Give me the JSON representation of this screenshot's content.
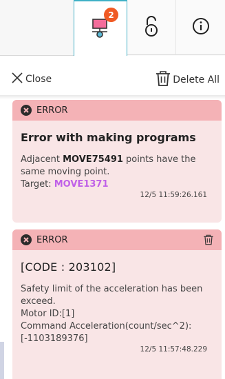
{
  "tabs": {
    "network_badge": "2",
    "network_icon": "network-alert-icon",
    "lock_icon": "unlock-icon",
    "info_icon": "info-icon",
    "colors": {
      "accent": "#3fb0c6",
      "badge": "#f05a24",
      "network_top": "#f46d9b",
      "network_bottom": "#5bb9d6"
    }
  },
  "toolbar": {
    "close_label": "Close",
    "delete_all_label": "Delete All"
  },
  "alerts": [
    {
      "level": "ERROR",
      "title": "Error with making programs",
      "msg_pre": "Adjacent ",
      "msg_bold": "MOVE75491",
      "msg_post": " points have the same moving point.",
      "target_label": "Target: ",
      "target_value": "MOVE1371",
      "timestamp": "12/5 11:59:26.161"
    },
    {
      "level": "ERROR",
      "title": "[CODE : 203102]",
      "line1": "Safety limit of the acceleration has been exceed.",
      "line2": "Motor ID:[1]",
      "line3": "Command Acceleration(count/sec^2):[-1103189376]",
      "timestamp": "12/5 11:57:48.229"
    }
  ],
  "colors": {
    "card_bg": "#f9e5e6",
    "card_header": "#f4b2b6",
    "target_link": "#c061e8"
  }
}
